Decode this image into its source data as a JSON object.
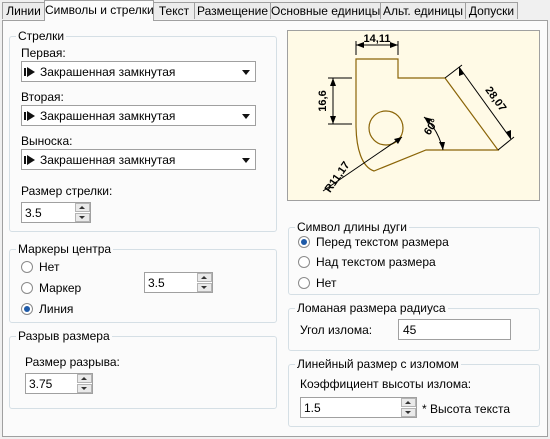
{
  "tabs": [
    {
      "label": "Линии"
    },
    {
      "label": "Символы и стрелки"
    },
    {
      "label": "Текст"
    },
    {
      "label": "Размещение"
    },
    {
      "label": "Основные единицы"
    },
    {
      "label": "Альт. единицы"
    },
    {
      "label": "Допуски"
    }
  ],
  "active_tab": "Символы и стрелки",
  "arrows": {
    "title": "Стрелки",
    "first_label": "Первая:",
    "first_value": "Закрашенная замкнутая",
    "second_label": "Вторая:",
    "second_value": "Закрашенная замкнутая",
    "leader_label": "Выноска:",
    "leader_value": "Закрашенная замкнутая",
    "size_label": "Размер стрелки:",
    "size_value": "3.5"
  },
  "center_marks": {
    "title": "Маркеры центра",
    "options": [
      "Нет",
      "Маркер",
      "Линия"
    ],
    "selected": "Линия",
    "size_value": "3.5"
  },
  "dim_break": {
    "title": "Разрыв размера",
    "size_label": "Размер разрыва:",
    "size_value": "3.75"
  },
  "preview": {
    "dims": [
      "14,11",
      "16,6",
      "28,07",
      "60°",
      "R11,17"
    ],
    "line_color": "#8b6508",
    "text_color": "#000000",
    "background": "#fffae6"
  },
  "arc_length": {
    "title": "Символ длины дуги",
    "options": [
      "Перед текстом размера",
      "Над текстом размера",
      "Нет"
    ],
    "selected": "Перед текстом размера"
  },
  "radius_jog": {
    "title": "Ломаная размера радиуса",
    "angle_label": "Угол излома:",
    "angle_value": "45"
  },
  "linear_jog": {
    "title": "Линейный размер с изломом",
    "factor_label": "Коэффициент высоты излома:",
    "factor_value": "1.5",
    "factor_suffix": "* Высота текста"
  },
  "colors": {
    "accent": "#1e5aa8",
    "border": "#a0a0a0",
    "pane": "#fbfbfb"
  }
}
